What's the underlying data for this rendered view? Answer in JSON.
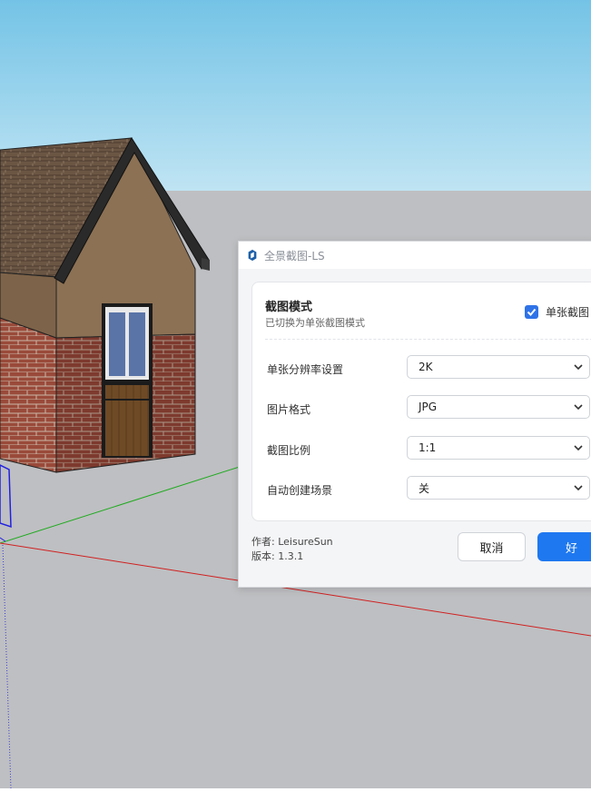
{
  "dialog": {
    "title": "全景截图-LS",
    "mode": {
      "title": "截图模式",
      "subtitle": "已切换为单张截图模式",
      "checkbox_label": "单张截图",
      "checked": true
    },
    "settings": [
      {
        "label": "单张分辨率设置",
        "value": "2K"
      },
      {
        "label": "图片格式",
        "value": "JPG"
      },
      {
        "label": "截图比例",
        "value": "1:1"
      },
      {
        "label": "自动创建场景",
        "value": "关"
      }
    ],
    "footer": {
      "author": "作者: LeisureSun",
      "version": "版本: 1.3.1"
    },
    "buttons": {
      "cancel": "取消",
      "ok": "好"
    }
  },
  "colors": {
    "sky": "#8fd0ee",
    "ground": "#bebfc2",
    "accent": "#1e78f0"
  }
}
